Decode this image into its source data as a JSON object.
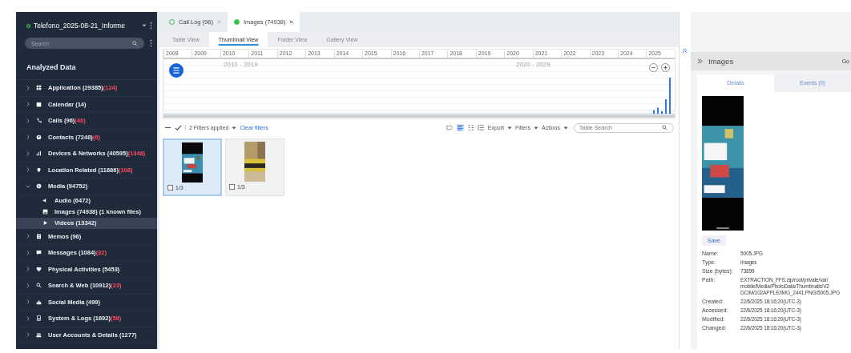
{
  "case": {
    "title": "Telefono_2025-08-21_Informe",
    "active": true
  },
  "sidebar": {
    "search": {
      "placeholder": "Search"
    },
    "heading": "Analyzed Data",
    "items": [
      {
        "label": "Application (29385)",
        "alert": "(124)",
        "expanded": false,
        "selected": false
      },
      {
        "label": "Calendar (14)",
        "expanded": false,
        "selected": false
      },
      {
        "label": "Calls (96)",
        "alert": "(46)",
        "expanded": false,
        "selected": false
      },
      {
        "label": "Contacts (7248)",
        "alert": "(6)",
        "expanded": false,
        "selected": false
      },
      {
        "label": "Devices & Networks (40595)",
        "alert": "(1348)",
        "expanded": false,
        "selected": false
      },
      {
        "label": "Location Related (11686)",
        "alert": "(108)",
        "expanded": false,
        "selected": false
      },
      {
        "label": "Media (94752)",
        "expanded": true,
        "selected": false,
        "children": [
          {
            "label": "Audio (6472)",
            "selected": false
          },
          {
            "label": "Images (74938)  (1 known files)",
            "selected": false
          },
          {
            "label": "Videos (13342)",
            "selected": true
          }
        ]
      },
      {
        "label": "Memos (96)",
        "expanded": false,
        "selected": false
      },
      {
        "label": "Messages (1084)",
        "alert": "(32)",
        "expanded": false,
        "selected": false
      },
      {
        "label": "Physical Activities (5453)",
        "expanded": false,
        "selected": false
      },
      {
        "label": "Search & Web (10912)",
        "alert": "(23)",
        "expanded": false,
        "selected": false
      },
      {
        "label": "Social Media (499)",
        "expanded": false,
        "selected": false
      },
      {
        "label": "System & Logs (1692)",
        "alert": "(58)",
        "expanded": false,
        "selected": false
      },
      {
        "label": "User Accounts & Details (1277)",
        "expanded": false,
        "selected": false
      }
    ]
  },
  "tabs": [
    {
      "label": "Call Log (96)",
      "selected": false,
      "filled": false
    },
    {
      "label": "Images (74938)",
      "selected": true,
      "filled": true
    }
  ],
  "views": [
    {
      "label": "Table View",
      "selected": false
    },
    {
      "label": "Thumbnail View",
      "selected": true
    },
    {
      "label": "Folder View",
      "selected": false
    },
    {
      "label": "Gallery View",
      "selected": false
    }
  ],
  "timeline": {
    "years": [
      "2008",
      "2009",
      "2010",
      "2011",
      "2012",
      "2013",
      "2014",
      "2015",
      "2016",
      "2017",
      "2018",
      "2019",
      "2020",
      "2021",
      "2022",
      "2023",
      "2024",
      "2025"
    ],
    "decades": [
      "2010 - 2019",
      "2020 - 2029"
    ]
  },
  "toolbar": {
    "filters_applied": "2 Filters applied",
    "clear": "Clear filters",
    "menus": [
      "Export",
      "Filters",
      "Actions"
    ],
    "search": {
      "placeholder": "Table Search"
    }
  },
  "thumbnails": [
    {
      "caption": "1/3",
      "selected": true,
      "checked": false,
      "kind": "picture"
    },
    {
      "caption": "1/3",
      "selected": false,
      "checked": false,
      "kind": "picture"
    }
  ],
  "details": {
    "title": "Images",
    "cut_label": "Go",
    "tabs": [
      {
        "label": "Details",
        "selected": true
      },
      {
        "label": "Events (0)",
        "selected": false
      }
    ],
    "save": "Save",
    "fields": [
      {
        "label": "Name:",
        "value": [
          "5005.JPG"
        ]
      },
      {
        "label": "Type:",
        "value": [
          "Images"
        ]
      },
      {
        "label": "Size (bytes):",
        "value": [
          "73899"
        ]
      },
      {
        "label": "Path:",
        "value": [
          "EXTRACTION_FFS.zip/root/private/var/",
          "mobile/Media/PhotoData/Thumbnails/V2",
          "DCIM/102APPLE/IMG_2441.PNG/5005.JPG"
        ]
      },
      {
        "label": "Created:",
        "value": [
          "22/6/2025 18:16:20(UTC-3)"
        ]
      },
      {
        "label": "Accessed:",
        "value": [
          "22/6/2025 18:16:20(UTC-3)"
        ]
      },
      {
        "label": "Modified:",
        "value": [
          "22/6/2025 18:16:20(UTC-3)"
        ]
      },
      {
        "label": "Changed:",
        "value": [
          "22/6/2025 18:16:20(UTC-3)"
        ]
      }
    ]
  }
}
